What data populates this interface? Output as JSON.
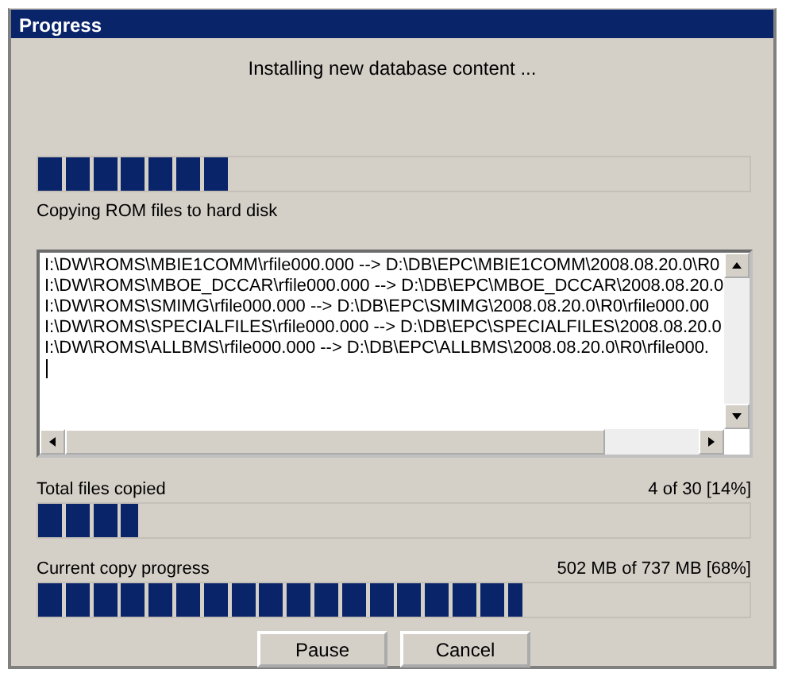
{
  "window": {
    "title": "Progress"
  },
  "heading": "Installing new database content ...",
  "stage_progress": {
    "level": 0.27
  },
  "stage_label": "Copying ROM files to hard disk",
  "log": {
    "lines": [
      "I:\\DW\\ROMS\\MBIE1COMM\\rfile000.000 --> D:\\DB\\EPC\\MBIE1COMM\\2008.08.20.0\\R0",
      "I:\\DW\\ROMS\\MBOE_DCCAR\\rfile000.000 --> D:\\DB\\EPC\\MBOE_DCCAR\\2008.08.20.0",
      "I:\\DW\\ROMS\\SMIMG\\rfile000.000 --> D:\\DB\\EPC\\SMIMG\\2008.08.20.0\\R0\\rfile000.00",
      "I:\\DW\\ROMS\\SPECIALFILES\\rfile000.000 --> D:\\DB\\EPC\\SPECIALFILES\\2008.08.20.0",
      "I:\\DW\\ROMS\\ALLBMS\\rfile000.000 --> D:\\DB\\EPC\\ALLBMS\\2008.08.20.0\\R0\\rfile000."
    ]
  },
  "total": {
    "label": "Total files copied",
    "reading": "4 of 30 [14%]",
    "level": 0.14
  },
  "current": {
    "label": "Current copy progress",
    "reading": "502 MB of 737 MB [68%]",
    "level": 0.68
  },
  "buttons": [
    "Pause",
    "Cancel"
  ]
}
